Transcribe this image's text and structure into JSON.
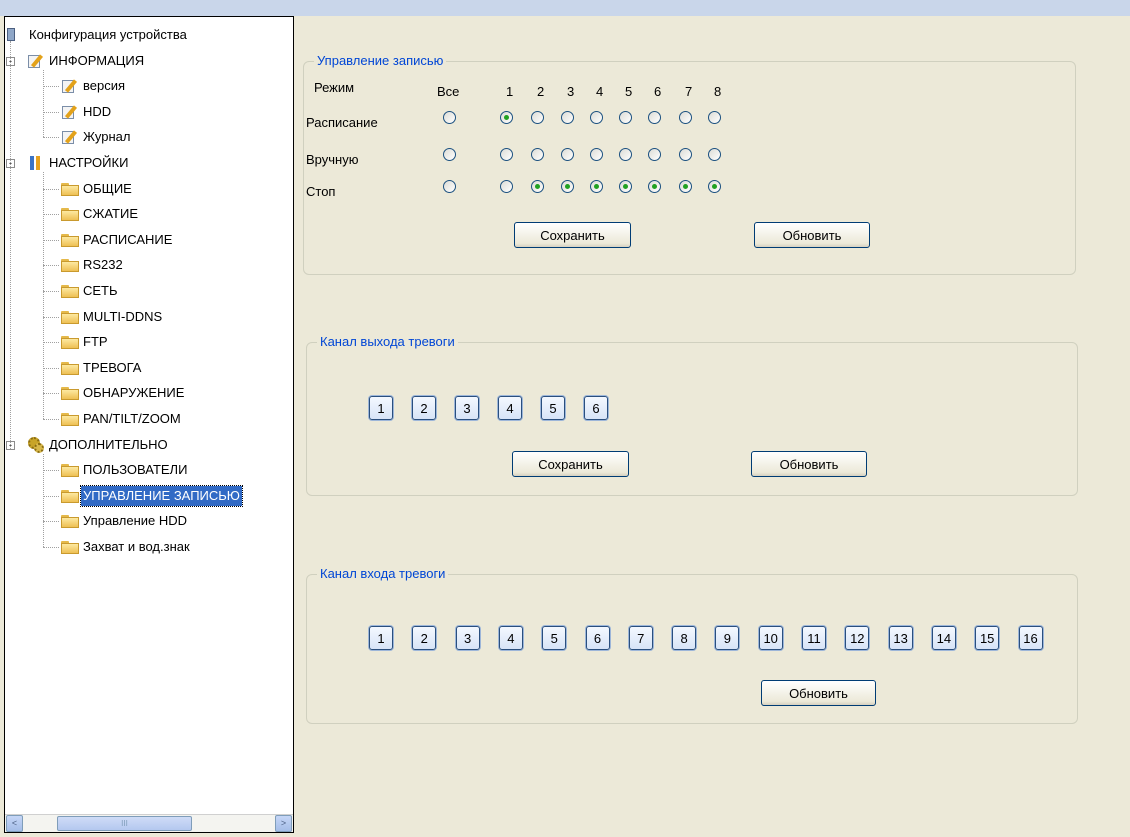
{
  "tree": {
    "root": {
      "label": "Конфигурация устройства",
      "icon": "computer-icon"
    },
    "groups": [
      {
        "label": "ИНФОРМАЦИЯ",
        "icon": "edit-document-icon",
        "expander": "-",
        "items": [
          {
            "label": "версия",
            "icon": "edit-document-icon"
          },
          {
            "label": "HDD",
            "icon": "edit-document-icon"
          },
          {
            "label": "Журнал",
            "icon": "edit-document-icon"
          }
        ]
      },
      {
        "label": "НАСТРОЙКИ",
        "icon": "tools-icon",
        "expander": "-",
        "items": [
          {
            "label": "ОБЩИЕ",
            "icon": "folder-icon"
          },
          {
            "label": "СЖАТИЕ",
            "icon": "folder-icon"
          },
          {
            "label": "РАСПИСАНИЕ",
            "icon": "folder-icon"
          },
          {
            "label": "RS232",
            "icon": "folder-icon"
          },
          {
            "label": "СЕТЬ",
            "icon": "folder-icon"
          },
          {
            "label": "MULTI-DDNS",
            "icon": "folder-icon"
          },
          {
            "label": "FTP",
            "icon": "folder-icon"
          },
          {
            "label": "ТРЕВОГА",
            "icon": "folder-icon"
          },
          {
            "label": "ОБНАРУЖЕНИЕ",
            "icon": "folder-icon"
          },
          {
            "label": "PAN/TILT/ZOOM",
            "icon": "folder-icon"
          }
        ]
      },
      {
        "label": "ДОПОЛНИТЕЛЬНО",
        "icon": "gears-icon",
        "expander": "-",
        "items": [
          {
            "label": "ПОЛЬЗОВАТЕЛИ",
            "icon": "folder-icon"
          },
          {
            "label": "УПРАВЛЕНИЕ ЗАПИСЬЮ",
            "icon": "folder-open-icon",
            "selected": true
          },
          {
            "label": "Управление HDD",
            "icon": "folder-icon"
          },
          {
            "label": "Захват и вод.знак",
            "icon": "folder-icon"
          }
        ]
      }
    ],
    "scrollbar": {
      "left": "<",
      "right": ">",
      "grip": "III"
    }
  },
  "record_control": {
    "title": "Управление записью",
    "mode_label": "Режим",
    "columns": [
      "Все",
      "1",
      "2",
      "3",
      "4",
      "5",
      "6",
      "7",
      "8"
    ],
    "rows": [
      {
        "label": "Расписание",
        "selected": [
          false,
          true,
          false,
          false,
          false,
          false,
          false,
          false,
          false
        ]
      },
      {
        "label": "Вручную",
        "selected": [
          false,
          false,
          false,
          false,
          false,
          false,
          false,
          false,
          false
        ]
      },
      {
        "label": "Стоп",
        "selected": [
          false,
          false,
          true,
          true,
          true,
          true,
          true,
          true,
          true
        ]
      }
    ],
    "save_label": "Сохранить",
    "refresh_label": "Обновить"
  },
  "alarm_out": {
    "title": "Канал выхода тревоги",
    "channels": [
      "1",
      "2",
      "3",
      "4",
      "5",
      "6"
    ],
    "save_label": "Сохранить",
    "refresh_label": "Обновить"
  },
  "alarm_in": {
    "title": "Канал входа тревоги",
    "channels": [
      "1",
      "2",
      "3",
      "4",
      "5",
      "6",
      "7",
      "8",
      "9",
      "10",
      "11",
      "12",
      "13",
      "14",
      "15",
      "16"
    ],
    "refresh_label": "Обновить"
  },
  "colors": {
    "background": "#ece9d8",
    "legend_text": "#0046d5",
    "selection": "#316ac5",
    "radio_dot": "#21a121"
  }
}
